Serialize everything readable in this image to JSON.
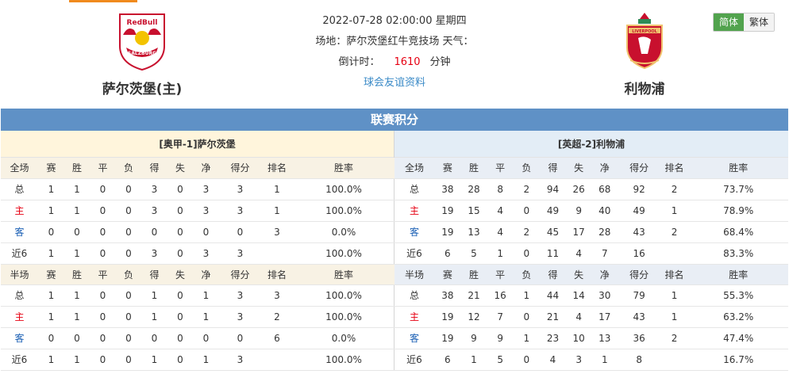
{
  "match": {
    "datetime": "2022-07-28 02:00:00 星期四",
    "venue": "场地：萨尔茨堡红牛竞技场 天气：",
    "countdown_label": "倒计时：",
    "countdown_value": "1610",
    "countdown_unit": "分钟",
    "friendly_link": "球会友谊资料"
  },
  "home_team": {
    "name": "萨尔茨堡(主)",
    "logo_icon": "red-bull-salzburg-crest"
  },
  "away_team": {
    "name": "利物浦",
    "logo_icon": "liverpool-crest"
  },
  "language": {
    "simplified": "简体",
    "traditional": "繁体"
  },
  "standings": {
    "title": "联赛积分",
    "home": {
      "header": "[奥甲-1]萨尔茨堡",
      "full": {
        "columns": [
          "全场",
          "赛",
          "胜",
          "平",
          "负",
          "得",
          "失",
          "净",
          "得分",
          "排名",
          "胜率"
        ],
        "rows": [
          [
            "总",
            "1",
            "1",
            "0",
            "0",
            "3",
            "0",
            "3",
            "3",
            "1",
            "100.0%"
          ],
          [
            "主",
            "1",
            "1",
            "0",
            "0",
            "3",
            "0",
            "3",
            "3",
            "1",
            "100.0%"
          ],
          [
            "客",
            "0",
            "0",
            "0",
            "0",
            "0",
            "0",
            "0",
            "0",
            "3",
            "0.0%"
          ],
          [
            "近6",
            "1",
            "1",
            "0",
            "0",
            "3",
            "0",
            "3",
            "3",
            "",
            "100.0%"
          ]
        ]
      },
      "half": {
        "columns": [
          "半场",
          "赛",
          "胜",
          "平",
          "负",
          "得",
          "失",
          "净",
          "得分",
          "排名",
          "胜率"
        ],
        "rows": [
          [
            "总",
            "1",
            "1",
            "0",
            "0",
            "1",
            "0",
            "1",
            "3",
            "3",
            "100.0%"
          ],
          [
            "主",
            "1",
            "1",
            "0",
            "0",
            "1",
            "0",
            "1",
            "3",
            "2",
            "100.0%"
          ],
          [
            "客",
            "0",
            "0",
            "0",
            "0",
            "0",
            "0",
            "0",
            "0",
            "6",
            "0.0%"
          ],
          [
            "近6",
            "1",
            "1",
            "0",
            "0",
            "1",
            "0",
            "1",
            "3",
            "",
            "100.0%"
          ]
        ]
      }
    },
    "away": {
      "header": "[英超-2]利物浦",
      "full": {
        "columns": [
          "全场",
          "赛",
          "胜",
          "平",
          "负",
          "得",
          "失",
          "净",
          "得分",
          "排名",
          "胜率"
        ],
        "rows": [
          [
            "总",
            "38",
            "28",
            "8",
            "2",
            "94",
            "26",
            "68",
            "92",
            "2",
            "73.7%"
          ],
          [
            "主",
            "19",
            "15",
            "4",
            "0",
            "49",
            "9",
            "40",
            "49",
            "1",
            "78.9%"
          ],
          [
            "客",
            "19",
            "13",
            "4",
            "2",
            "45",
            "17",
            "28",
            "43",
            "2",
            "68.4%"
          ],
          [
            "近6",
            "6",
            "5",
            "1",
            "0",
            "11",
            "4",
            "7",
            "16",
            "",
            "83.3%"
          ]
        ]
      },
      "half": {
        "columns": [
          "半场",
          "赛",
          "胜",
          "平",
          "负",
          "得",
          "失",
          "净",
          "得分",
          "排名",
          "胜率"
        ],
        "rows": [
          [
            "总",
            "38",
            "21",
            "16",
            "1",
            "44",
            "14",
            "30",
            "79",
            "1",
            "55.3%"
          ],
          [
            "主",
            "19",
            "12",
            "7",
            "0",
            "21",
            "4",
            "17",
            "43",
            "1",
            "63.2%"
          ],
          [
            "客",
            "19",
            "9",
            "9",
            "1",
            "23",
            "10",
            "13",
            "36",
            "2",
            "47.4%"
          ],
          [
            "近6",
            "6",
            "1",
            "5",
            "0",
            "4",
            "3",
            "1",
            "8",
            "",
            "16.7%"
          ]
        ]
      }
    }
  }
}
